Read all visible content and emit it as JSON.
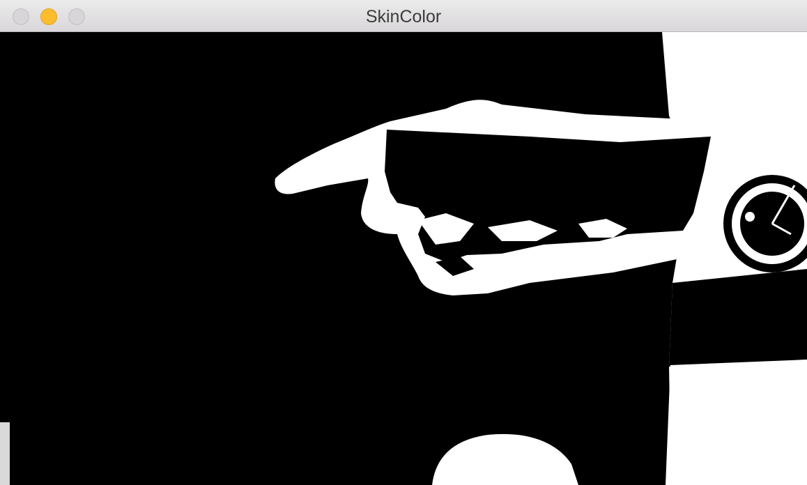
{
  "window": {
    "title": "SkinColor"
  },
  "traffic_lights": {
    "close_icon": "close-icon",
    "minimize_icon": "minimize-icon",
    "zoom_icon": "zoom-icon",
    "minimize_color": "#fbbd2e"
  },
  "image": {
    "description_icon": "binary-skin-mask",
    "foreground_color": "#ffffff",
    "background_color": "#000000"
  }
}
